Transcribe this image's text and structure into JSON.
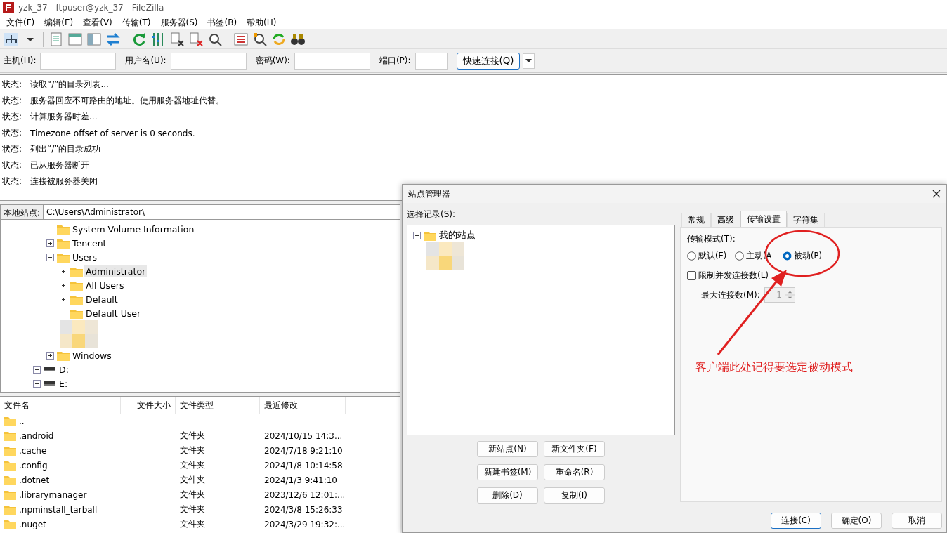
{
  "window": {
    "title": "yzk_37 - ftpuser@yzk_37 - FileZilla"
  },
  "menu": [
    "文件(F)",
    "编辑(E)",
    "查看(V)",
    "传输(T)",
    "服务器(S)",
    "书签(B)",
    "帮助(H)"
  ],
  "quickconnect": {
    "fields": [
      {
        "label": "主机(H):",
        "kind": "wide"
      },
      {
        "label": "用户名(U):",
        "kind": "wide"
      },
      {
        "label": "密码(W):",
        "kind": "wide"
      },
      {
        "label": "端口(P):",
        "kind": "narrow"
      }
    ],
    "button": "快速连接(Q)"
  },
  "log": [
    {
      "label": "状态:",
      "text": "读取“/”的目录列表..."
    },
    {
      "label": "状态:",
      "text": "服务器回应不可路由的地址。使用服务器地址代替。"
    },
    {
      "label": "状态:",
      "text": "计算服务器时差..."
    },
    {
      "label": "状态:",
      "text": "Timezone offset of server is 0 seconds."
    },
    {
      "label": "状态:",
      "text": "列出“/”的目录成功"
    },
    {
      "label": "状态:",
      "text": "已从服务器断开"
    },
    {
      "label": "状态:",
      "text": "连接被服务器关闭"
    }
  ],
  "local_site": {
    "label": "本地站点:",
    "path": "C:\\Users\\Administrator\\",
    "tree": [
      {
        "kind": "hidden",
        "children": [
          {
            "kind": "folder",
            "name": "System Volume Information",
            "selected": false
          },
          {
            "kind": "folder",
            "name": "Tencent",
            "expanded": false,
            "selected": false
          },
          {
            "kind": "folder",
            "name": "Users",
            "expanded": true,
            "selected": false,
            "children": [
              {
                "kind": "folder",
                "name": "Administrator",
                "expanded": false,
                "selected": true
              },
              {
                "kind": "folder",
                "name": "All Users",
                "expanded": false,
                "selected": false
              },
              {
                "kind": "folder",
                "name": "Default",
                "expanded": false,
                "selected": false
              },
              {
                "kind": "folder",
                "name": "Default User",
                "selected": false
              },
              {
                "kind": "obscured"
              }
            ]
          },
          {
            "kind": "folder",
            "name": "Windows",
            "expanded": false,
            "selected": false
          }
        ]
      },
      {
        "kind": "drive",
        "name": "D:",
        "expanded": false,
        "selected": false
      },
      {
        "kind": "drive",
        "name": "E:",
        "expanded": false,
        "selected": false
      }
    ]
  },
  "file_list": {
    "columns": [
      "文件名",
      "文件大小",
      "文件类型",
      "最近修改"
    ],
    "rows": [
      {
        "name": "..",
        "size": "",
        "type": "",
        "modified": ""
      },
      {
        "name": ".android",
        "type": "文件夹",
        "modified": "2024/10/15 14:3..."
      },
      {
        "name": ".cache",
        "type": "文件夹",
        "modified": "2024/7/18 9:21:10"
      },
      {
        "name": ".config",
        "type": "文件夹",
        "modified": "2024/1/8 10:14:58"
      },
      {
        "name": ".dotnet",
        "type": "文件夹",
        "modified": "2024/1/3 9:41:10"
      },
      {
        "name": ".librarymanager",
        "type": "文件夹",
        "modified": "2023/12/6 12:01:..."
      },
      {
        "name": ".npminstall_tarball",
        "type": "文件夹",
        "modified": "2024/3/8 15:26:33"
      },
      {
        "name": ".nuget",
        "type": "文件夹",
        "modified": "2024/3/29 19:32:..."
      }
    ]
  },
  "dialog": {
    "title": "站点管理器",
    "select_label": "选择记录(S):",
    "site_tree": [
      {
        "kind": "folder",
        "name": "我的站点",
        "expanded": true,
        "children": [
          {
            "kind": "obscured"
          }
        ]
      }
    ],
    "buttons": [
      [
        "新站点(N)",
        "新文件夹(F)"
      ],
      [
        "新建书签(M)",
        "重命名(R)"
      ],
      [
        "删除(D)",
        "复制(I)"
      ]
    ],
    "tabs": [
      {
        "label": "常规",
        "selected": false
      },
      {
        "label": "高级",
        "selected": false
      },
      {
        "label": "传输设置",
        "selected": true
      },
      {
        "label": "字符集",
        "selected": false
      }
    ],
    "transfer_mode_label": "传输模式(T):",
    "modes": [
      {
        "label": "默认(E)",
        "selected": false
      },
      {
        "label": "主动(A",
        "selected": false
      },
      {
        "label": "被动(P)",
        "selected": true
      }
    ],
    "limit": {
      "label": "限制并发连接数(L)",
      "checked": false
    },
    "max_connections": {
      "label": "最大连接数(M):",
      "value": "1",
      "disabled": true
    },
    "footer": [
      {
        "label": "连接(C)",
        "default": true
      },
      {
        "label": "确定(O)",
        "default": false
      },
      {
        "label": "取消",
        "default": false
      }
    ]
  },
  "annotation": {
    "text": "客户端此处记得要选定被动模式"
  }
}
